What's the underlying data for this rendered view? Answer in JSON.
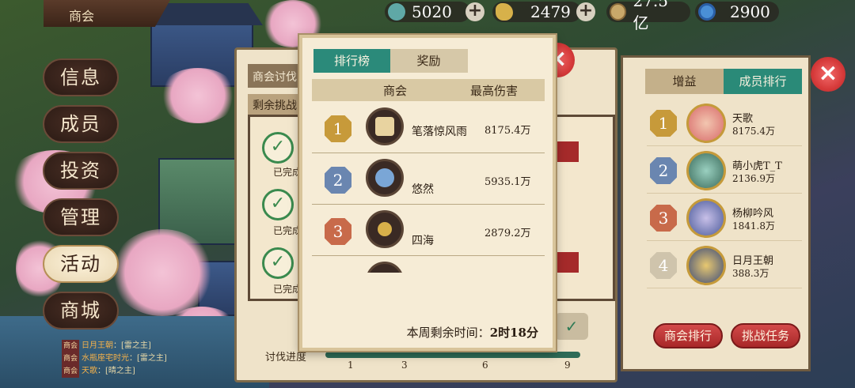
{
  "top_tab": {
    "label": "商会"
  },
  "currency": [
    {
      "icon": "jade-icon",
      "value": "5020",
      "color": "#5fa8a6",
      "has_plus": true
    },
    {
      "icon": "gold-ingot-icon",
      "value": "2479",
      "color": "#d7b14a",
      "has_plus": true
    },
    {
      "icon": "coin-icon",
      "value": "27.5亿",
      "color": "#c9a86a",
      "has_plus": false
    },
    {
      "icon": "gem-icon",
      "value": "2900",
      "color": "#4a8fd6",
      "has_plus": false
    }
  ],
  "left_menu": [
    {
      "label": "信息",
      "active": false
    },
    {
      "label": "成员",
      "active": false
    },
    {
      "label": "投资",
      "active": false
    },
    {
      "label": "管理",
      "active": false
    },
    {
      "label": "活动",
      "active": true
    },
    {
      "label": "商城",
      "active": false
    }
  ],
  "chat": [
    {
      "tag": "商会",
      "name": "日月王朝",
      "text": "[雷之主]"
    },
    {
      "tag": "商会",
      "name": "水瓶座宅时光",
      "text": "[雷之主]"
    },
    {
      "tag": "商会",
      "name": "天歌",
      "text": "[晴之主]"
    }
  ],
  "back_panel": {
    "header": "商会讨伐",
    "sub": "剩余挑战",
    "done_label": "已完成",
    "progress_label": "讨伐进度",
    "progress_nodes": [
      "1",
      "3",
      "6",
      "9"
    ]
  },
  "right_panel": {
    "tabs": [
      {
        "label": "增益",
        "active": false
      },
      {
        "label": "成员排行",
        "active": true
      }
    ],
    "members": [
      {
        "rank": "1",
        "name": "天歌",
        "value": "8175.4万",
        "rank_color": "#c79a3a",
        "avatar_color": "#d86a6a"
      },
      {
        "rank": "2",
        "name": "萌小虎T_T",
        "value": "2136.9万",
        "rank_color": "#6a86b0",
        "avatar_color": "#3a6a5a"
      },
      {
        "rank": "3",
        "name": "杨柳吟风",
        "value": "1841.8万",
        "rank_color": "#c86a4a",
        "avatar_color": "#4a5a9a"
      },
      {
        "rank": "4",
        "name": "日月王朝",
        "value": "388.3万",
        "rank_color": "#cfc4ac",
        "avatar_color": "#3a4a7a"
      }
    ],
    "buttons": {
      "guild_rank": "商会排行",
      "challenge_task": "挑战任务"
    }
  },
  "modal": {
    "tabs": [
      {
        "label": "排行榜",
        "active": true
      },
      {
        "label": "奖励",
        "active": false
      }
    ],
    "columns": {
      "guild": "商会",
      "max_damage": "最高伤害"
    },
    "rows": [
      {
        "rank": "1",
        "guild": "笔落惊风雨",
        "damage": "8175.4万",
        "rank_color": "#c79a3a",
        "emblem": "scroll-emblem-icon",
        "emblem_color": "#e8d3a0"
      },
      {
        "rank": "2",
        "guild": "悠然",
        "damage": "5935.1万",
        "rank_color": "#6a86b0",
        "emblem": "handshake-emblem-icon",
        "emblem_color": "#7aa6d6"
      },
      {
        "rank": "3",
        "guild": "四海",
        "damage": "2879.2万",
        "rank_color": "#c86a4a",
        "emblem": "coin-emblem-icon",
        "emblem_color": "#d8b04a"
      }
    ],
    "footer_label": "本周剩余时间：",
    "footer_time": "2时18分"
  }
}
